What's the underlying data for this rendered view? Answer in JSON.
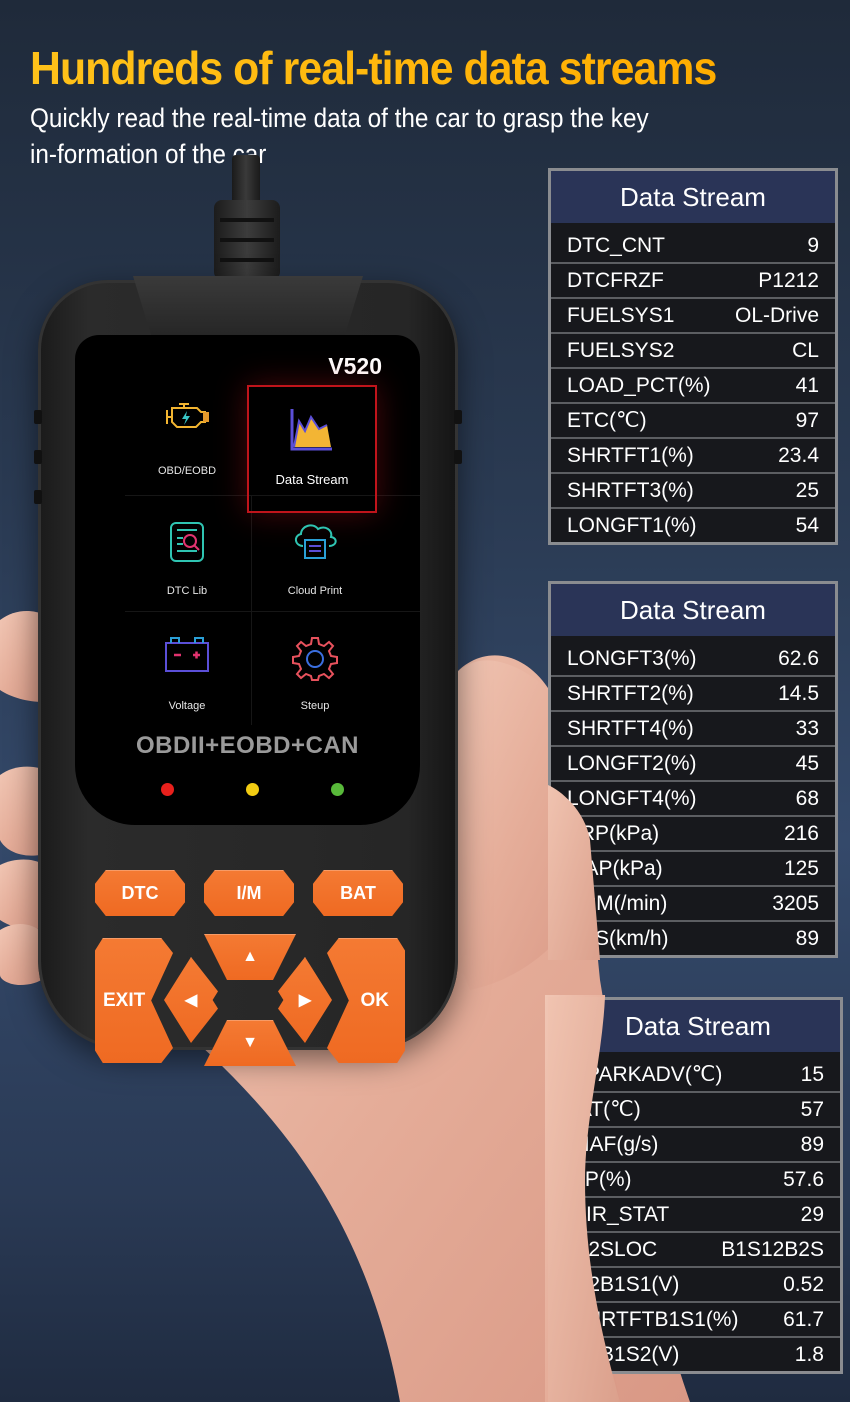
{
  "header": {
    "headline": "Hundreds of real-time data streams",
    "subtitle": "Quickly read the real-time data of the car to grasp the key in-formation of the car"
  },
  "colors": {
    "headline": "#ffb400",
    "panel_header_bg": "#2a3457",
    "panel_body_bg": "#17181c",
    "key_orange": "#ef6a22",
    "active_tile_border": "#c0141b"
  },
  "device": {
    "model": "V520",
    "menu": [
      {
        "label": "OBD/EOBD",
        "icon": "engine-check-icon"
      },
      {
        "label": "Data Stream",
        "icon": "chart-area-icon",
        "selected": true
      },
      {
        "label": "DTC Lib",
        "icon": "document-search-icon"
      },
      {
        "label": "Cloud Print",
        "icon": "cloud-print-icon"
      },
      {
        "label": "Voltage",
        "icon": "battery-icon"
      },
      {
        "label": "Steup",
        "icon": "gear-icon"
      }
    ],
    "protocol": "OBDII+EOBD+CAN",
    "leds": [
      {
        "name": "red",
        "color": "#e8201c"
      },
      {
        "name": "yellow",
        "color": "#f2cc12"
      },
      {
        "name": "green",
        "color": "#58b93a"
      }
    ],
    "keys": {
      "dtc": "DTC",
      "im": "I/M",
      "bat": "BAT",
      "exit": "EXIT",
      "ok": "OK",
      "up": "▲",
      "down": "▼",
      "left": "◀",
      "right": "▶"
    }
  },
  "panels": [
    {
      "title": "Data Stream",
      "rows": [
        {
          "name": "DTC_CNT",
          "value": "9"
        },
        {
          "name": "DTCFRZF",
          "value": "P1212"
        },
        {
          "name": "FUELSYS1",
          "value": "OL-Drive"
        },
        {
          "name": "FUELSYS2",
          "value": "CL"
        },
        {
          "name": "LOAD_PCT(%)",
          "value": "41"
        },
        {
          "name": "ETC(℃)",
          "value": "97"
        },
        {
          "name": "SHRTFT1(%)",
          "value": "23.4"
        },
        {
          "name": "SHRTFT3(%)",
          "value": "25"
        },
        {
          "name": "LONGFT1(%)",
          "value": "54"
        }
      ]
    },
    {
      "title": "Data Stream",
      "rows": [
        {
          "name": "LONGFT3(%)",
          "value": "62.6"
        },
        {
          "name": "SHRTFT2(%)",
          "value": "14.5"
        },
        {
          "name": "SHRTFT4(%)",
          "value": "33"
        },
        {
          "name": "LONGFT2(%)",
          "value": "45"
        },
        {
          "name": "LONGFT4(%)",
          "value": "68"
        },
        {
          "name": "FRP(kPa)",
          "value": "216"
        },
        {
          "name": "MAP(kPa)",
          "value": "125"
        },
        {
          "name": "RPM(/min)",
          "value": "3205"
        },
        {
          "name": "VSS(km/h)",
          "value": "89"
        }
      ]
    },
    {
      "title": "Data Stream",
      "rows": [
        {
          "name": "SPARKADV(℃)",
          "value": "15"
        },
        {
          "name": "IAT(℃)",
          "value": "57"
        },
        {
          "name": "MAF(g/s)",
          "value": "89"
        },
        {
          "name": "TP(%)",
          "value": "57.6"
        },
        {
          "name": "AIR_STAT",
          "value": "29"
        },
        {
          "name": "O2SLOC",
          "value": "B1S12B2S"
        },
        {
          "name": "O2B1S1(V)",
          "value": "0.52"
        },
        {
          "name": "SHRTFTB1S1(%)",
          "value": "61.7"
        },
        {
          "name": "O2B1S2(V)",
          "value": "1.8"
        }
      ]
    }
  ]
}
